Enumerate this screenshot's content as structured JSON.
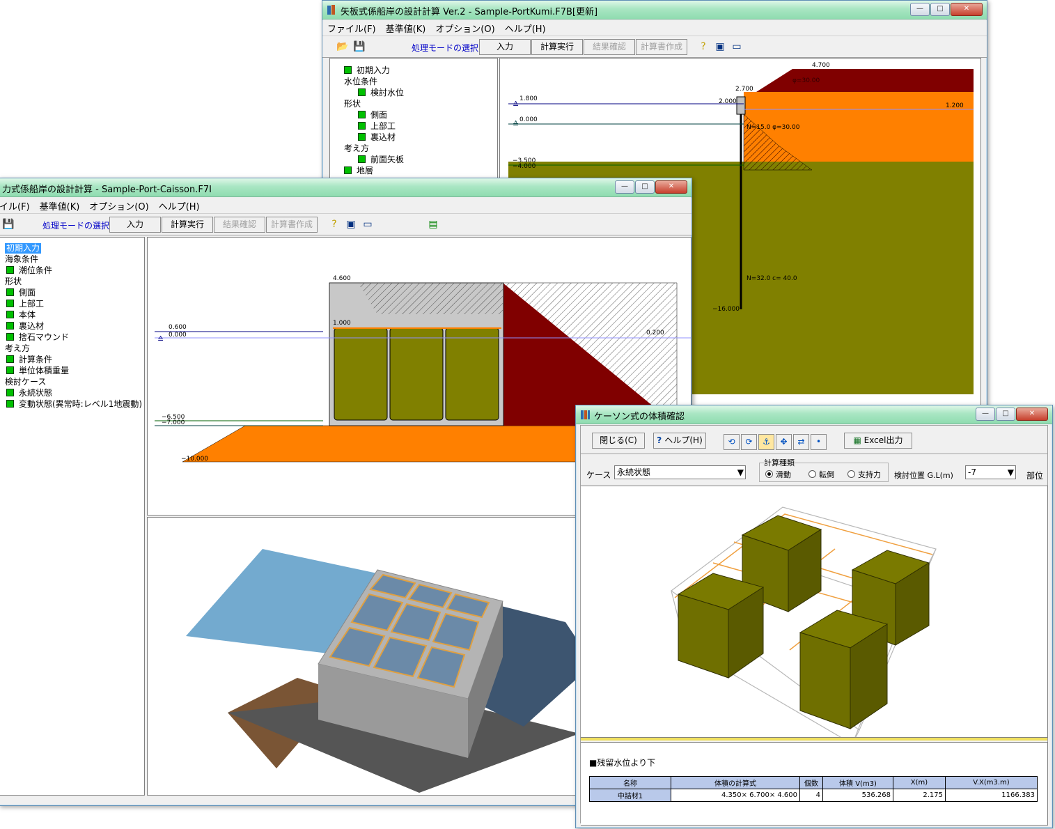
{
  "window_kumi": {
    "title": "矢板式係船岸の設計計算 Ver.2 - Sample-PortKumi.F7B[更新]",
    "menu": [
      "ファイル(F)",
      "基準値(K)",
      "オプション(O)",
      "ヘルプ(H)"
    ],
    "toolbar": {
      "mode_label": "処理モードの選択",
      "mode_value": "入力",
      "run": "計算実行",
      "result": "結果確認",
      "report": "計算書作成"
    },
    "tree": [
      {
        "label": "初期入力",
        "checked": true
      },
      {
        "label": "水位条件"
      },
      {
        "label": "検討水位"
      },
      {
        "label": "形状"
      },
      {
        "label": "側面"
      },
      {
        "label": "上部工"
      },
      {
        "label": "裏込材"
      },
      {
        "label": "考え方"
      },
      {
        "label": "前面矢板"
      },
      {
        "label": "地層"
      }
    ],
    "drawing": {
      "labels": [
        "4.700",
        "2.700",
        "2.000",
        "1.800",
        "0.000",
        "1.200",
        "−3.500",
        "−4.000",
        "−16.000",
        "φ=30.00",
        "N=15.0  φ=30.00",
        "N=32.0  c=  40.0"
      ]
    }
  },
  "window_caisson": {
    "title": "力式係船岸の設計計算 - Sample-Port-Caisson.F7I",
    "menu": [
      "イル(F)",
      "基準値(K)",
      "オプション(O)",
      "ヘルプ(H)"
    ],
    "toolbar": {
      "mode_label": "処理モードの選択",
      "mode_value": "入力",
      "run": "計算実行",
      "result": "結果確認",
      "report": "計算書作成"
    },
    "tree": [
      {
        "label": "初期入力",
        "selected": true
      },
      {
        "label": "海象条件"
      },
      {
        "label": "潮位条件"
      },
      {
        "label": "形状"
      },
      {
        "label": "側面"
      },
      {
        "label": "上部工"
      },
      {
        "label": "本体"
      },
      {
        "label": "裏込材"
      },
      {
        "label": "捨石マウンド"
      },
      {
        "label": "考え方"
      },
      {
        "label": "計算条件"
      },
      {
        "label": "単位体積重量"
      },
      {
        "label": "検討ケース"
      },
      {
        "label": "永続状態"
      },
      {
        "label": "変動状態(異常時:レベル1地震動)"
      }
    ],
    "drawing": {
      "labels": [
        "4.600",
        "1.000",
        "0.600",
        "0.000",
        "0.200",
        "−6.500",
        "−7.000",
        "−10.000"
      ]
    }
  },
  "window_volume": {
    "title": "ケーソン式の体積確認",
    "buttons": {
      "close": "閉じる(C)",
      "help": "ヘルプ(H)",
      "excel": "Excel出力"
    },
    "case_label": "ケース",
    "case_value": "永続状態",
    "calc_type_label": "計算種類",
    "radios": [
      {
        "label": "滑動",
        "on": true
      },
      {
        "label": "転倒",
        "on": false
      },
      {
        "label": "支持力",
        "on": false
      }
    ],
    "position_label": "検討位置 G.L(m)",
    "position_value": "-7",
    "part_label": "部位",
    "section_heading": "■残留水位より下",
    "table": {
      "headers": [
        "名称",
        "体積の計算式",
        "個数",
        "体積 V(m3)",
        "X(m)",
        "V.X(m3.m)"
      ],
      "rows": [
        [
          "中詰材1",
          "4.350× 6.700× 4.600",
          "4",
          "536.268",
          "2.175",
          "1166.383"
        ]
      ]
    },
    "colors": {
      "fill": "#6f6f00",
      "frame": "#f0a040"
    }
  },
  "colors": {
    "backfill_red": "#800000",
    "soil_orange": "#ff8000",
    "soil_olive": "#808000",
    "caisson_fill": "#808000",
    "title_green": "#a9e6c3",
    "water_blue": "#000080"
  }
}
